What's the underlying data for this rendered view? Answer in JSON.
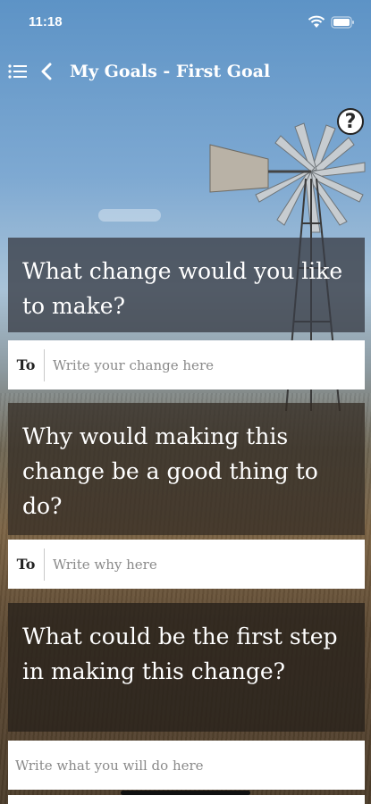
{
  "status": {
    "time": "11:18"
  },
  "nav": {
    "title": "My Goals - First Goal"
  },
  "help": {
    "label": "?"
  },
  "cards": [
    {
      "question": "What change would you like to make?",
      "prefix": "To",
      "placeholder": "Write your change here"
    },
    {
      "question": "Why would making this change be a good thing to do?",
      "prefix": "To",
      "placeholder": "Write why here"
    },
    {
      "question": "What could be the first step in making this change?",
      "prefix": "",
      "placeholder": "Write what you will do here"
    }
  ],
  "icons": [
    "menu-icon",
    "back-icon",
    "wifi-icon",
    "battery-icon",
    "help-icon"
  ]
}
